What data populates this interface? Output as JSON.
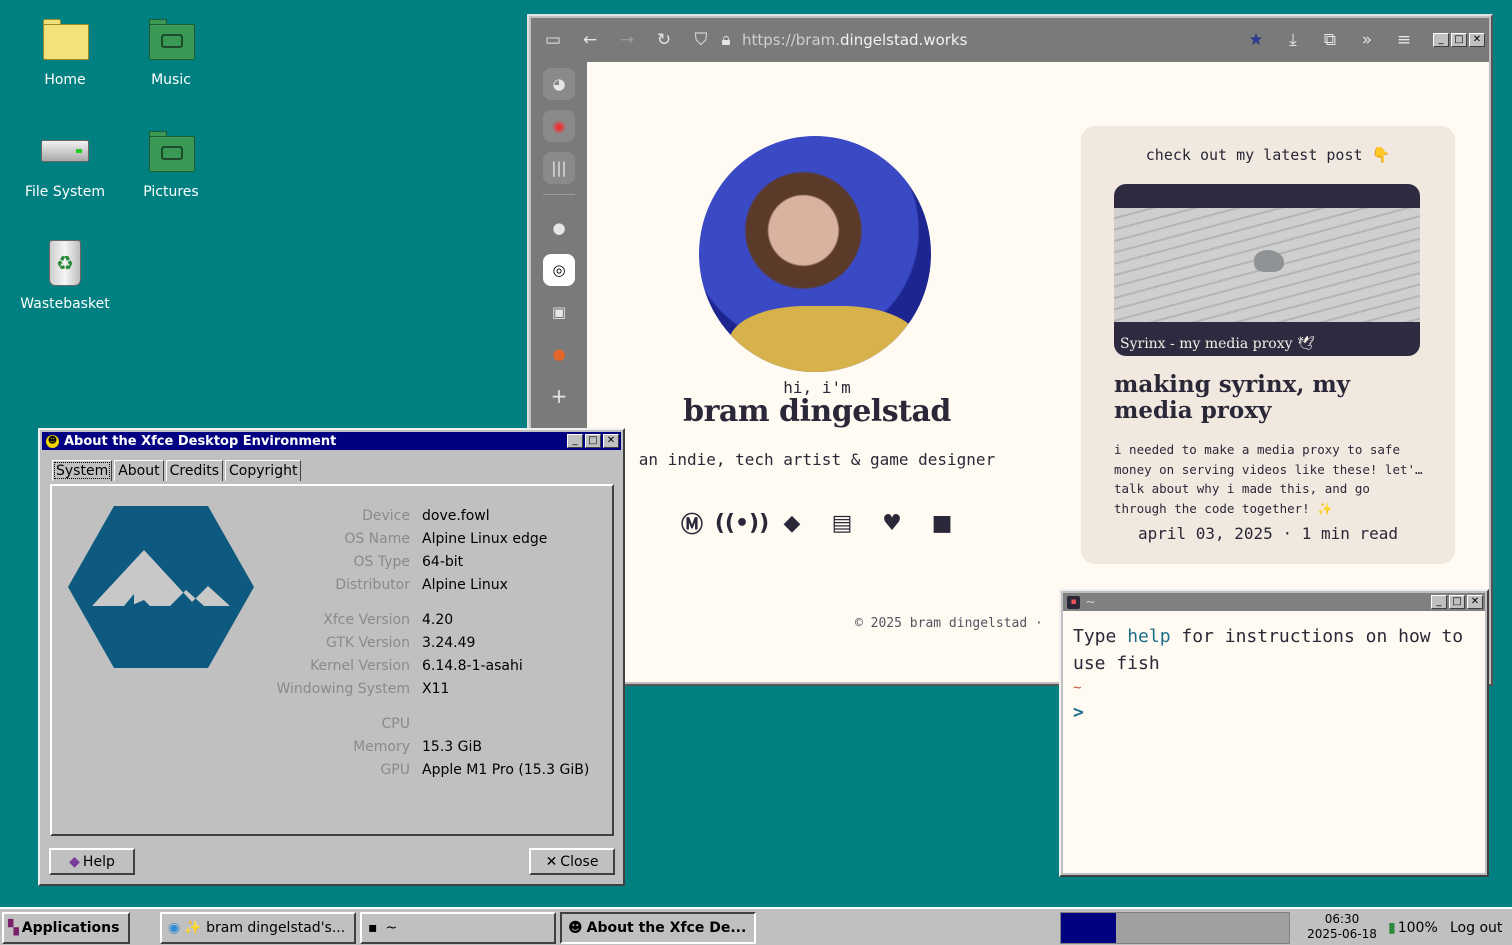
{
  "desktop": {
    "icons": [
      {
        "label": "Home"
      },
      {
        "label": "Music"
      },
      {
        "label": "File System"
      },
      {
        "label": "Pictures"
      },
      {
        "label": "Wastebasket"
      }
    ]
  },
  "browser": {
    "url_prefix": "https://bram.",
    "url_domain": "dingelstad.works",
    "sidebar_icons": [
      "discord-icon",
      "messenger-icon",
      "library-icon",
      "github-icon",
      "chatgpt-icon",
      "fish-icon",
      "duckduckgo-icon",
      "add-icon"
    ],
    "page": {
      "hi": "hi, i'm",
      "name": "bram dingelstad",
      "tagline": "an indie, tech artist & game designer",
      "social_icons": [
        "mastodon-icon",
        "podcast-icon",
        "git-icon",
        "itch-icon",
        "ko-fi-icon",
        "video-icon"
      ],
      "footer": "© 2025 bram dingelstad ·",
      "post": {
        "heading": "check out my latest post 👇",
        "image_caption": "Syrinx - my media proxy 🕊",
        "title": "making syrinx, my media proxy",
        "body": "i needed to make a media proxy to safe money on serving videos like these! let'… talk about why i made this, and go through the code together! ✨",
        "meta": "april 03, 2025 · 1 min read"
      }
    }
  },
  "about": {
    "title": "About the Xfce Desktop Environment",
    "tabs": [
      "System",
      "About",
      "Credits",
      "Copyright"
    ],
    "info": [
      {
        "k": "Device",
        "v": "dove.fowl"
      },
      {
        "k": "OS Name",
        "v": "Alpine Linux edge"
      },
      {
        "k": "OS Type",
        "v": "64-bit"
      },
      {
        "k": "Distributor",
        "v": "Alpine Linux"
      },
      {
        "k": "Xfce Version",
        "v": "4.20"
      },
      {
        "k": "GTK Version",
        "v": "3.24.49"
      },
      {
        "k": "Kernel Version",
        "v": "6.14.8-1-asahi"
      },
      {
        "k": "Windowing System",
        "v": "X11"
      },
      {
        "k": "CPU",
        "v": ""
      },
      {
        "k": "Memory",
        "v": "15.3 GiB"
      },
      {
        "k": "GPU",
        "v": "Apple M1 Pro (15.3 GiB)"
      }
    ],
    "help_label": "Help",
    "close_label": "Close"
  },
  "terminal": {
    "title": "~",
    "line1_pre": "Type ",
    "line1_hl": "help",
    "line1_post": " for instructions on how to use fish",
    "cwd": "~",
    "prompt": ">"
  },
  "taskbar": {
    "applications": "Applications",
    "tasks": [
      "✨ bram dingelstad's...",
      "~",
      "About the Xfce De..."
    ],
    "clock_time": "06:30",
    "clock_date": "2025-06-18",
    "battery": "100%",
    "logout": "Log out"
  },
  "colors": {
    "desktop": "#008080",
    "titlebar_active": "#000080",
    "alpine_blue": "#0d597f",
    "page_bg": "#fffaf2"
  }
}
